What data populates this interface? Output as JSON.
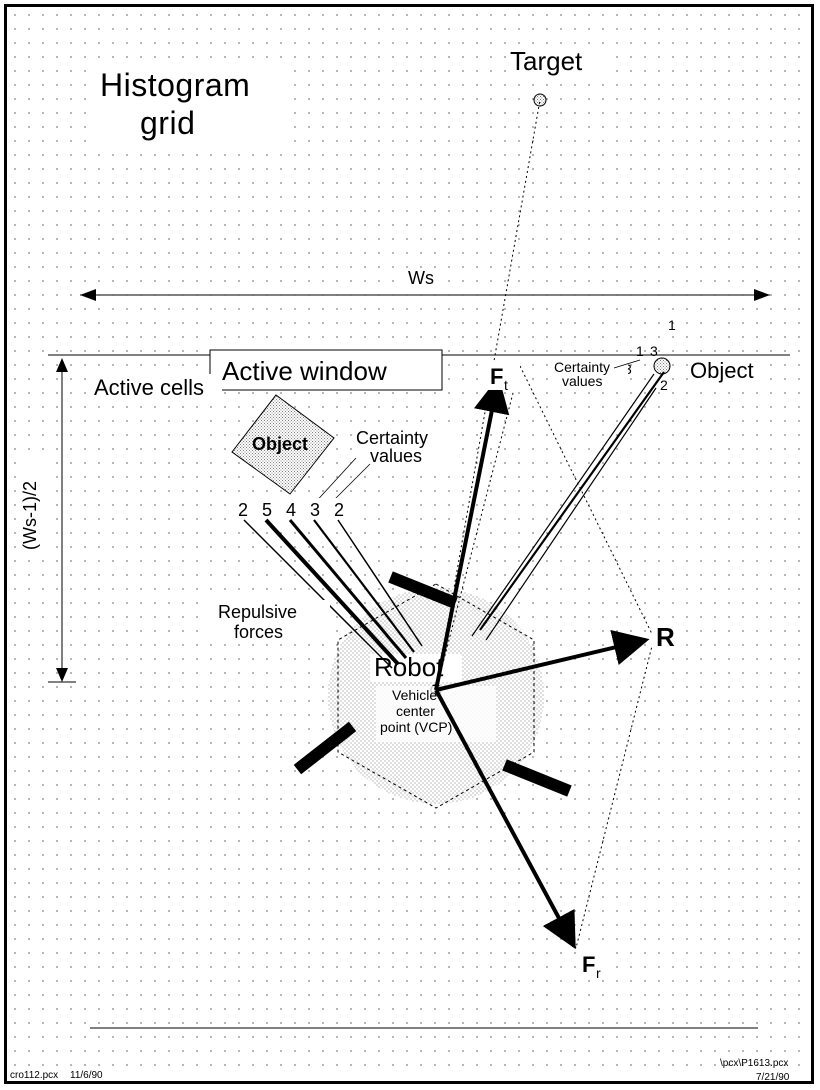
{
  "title": {
    "l1": "Histogram",
    "l2": "grid"
  },
  "target_label": "Target",
  "ws_label": "Ws",
  "side_label": "(Ws-1)/2",
  "active_window": "Active window",
  "active_cells": "Active cells",
  "object1": "Object",
  "object2": "Object",
  "certainty_label1": "Certainty",
  "certainty_label1b": "values",
  "certainty_label2": "Certainty",
  "certainty_label2b": "values",
  "cv1": [
    "2",
    "5",
    "4",
    "3",
    "2"
  ],
  "cv2": {
    "a": "1",
    "b": "1",
    "c": "3",
    "d": "3",
    "e": "2"
  },
  "repulsive": {
    "l1": "Repulsive",
    "l2": "forces"
  },
  "robot_label": "Robot",
  "vcp": {
    "l1": "Vehicle",
    "l2": "center",
    "l3": "point (VCP)"
  },
  "Ft": "F",
  "Ft_sub": "t",
  "Fr": "F",
  "Fr_sub": "r",
  "R": "R",
  "footer_left_a": "cro112.pcx",
  "footer_left_b": "11/6/90",
  "footer_right_a": "\\pcx\\P1613.pcx",
  "footer_right_b": "7/21/90"
}
